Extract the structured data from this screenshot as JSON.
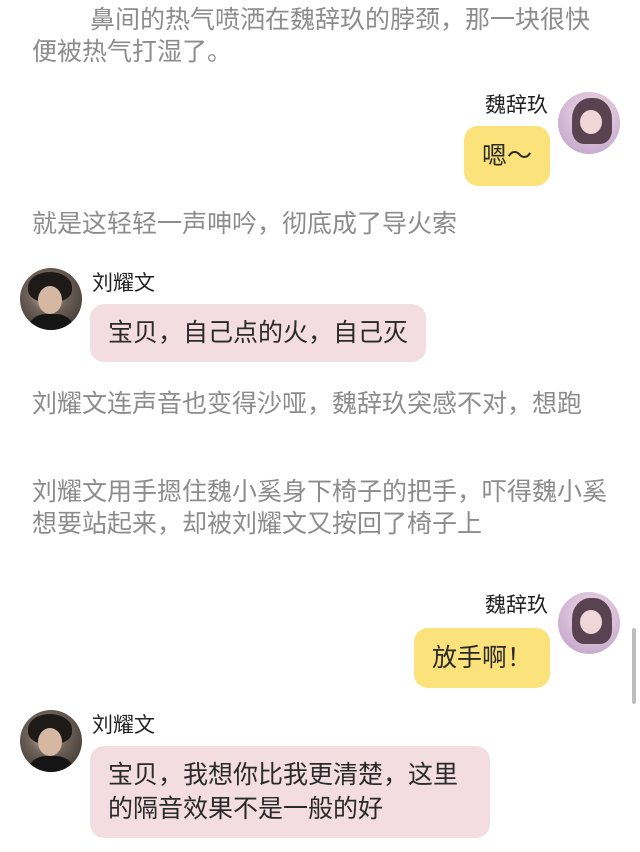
{
  "narration": [
    "鼻间的热气喷洒在魏辞玖的脖颈，那一块很快便被热气打湿了。",
    "就是这轻轻一声呻吟，彻底成了导火索",
    "刘耀文连声音也变得沙哑，魏辞玖突感不对，想跑",
    "刘耀文用手摁住魏小奚身下椅子的把手，吓得魏小奚想要站起来，却被刘耀文又按回了椅子上"
  ],
  "messages": [
    {
      "sender": "魏辞玖",
      "text": "嗯～"
    },
    {
      "sender": "刘耀文",
      "text": "宝贝，自己点的火，自己灭"
    },
    {
      "sender": "魏辞玖",
      "text": "放手啊！"
    },
    {
      "sender": "刘耀文",
      "text": "宝贝，我想你比我更清楚，这里的隔音效果不是一般的好"
    }
  ],
  "colors": {
    "right_bubble": "#fbe27a",
    "left_bubble": "#f3dde0",
    "narration_text": "#8c8c8c"
  }
}
